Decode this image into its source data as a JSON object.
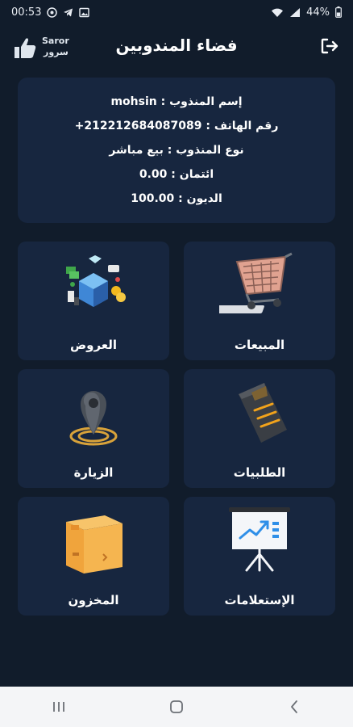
{
  "status_bar": {
    "time": "00:53",
    "battery": "44%",
    "icons": [
      "whatsapp-icon",
      "telegram-icon",
      "gallery-icon",
      "wifi-icon",
      "signal-icon",
      "battery-icon"
    ]
  },
  "header": {
    "title": "فضاء المندوبين",
    "logo_text": "Saror",
    "logo_text_ar": "سرور"
  },
  "info": {
    "name_label": "إسم المنذوب :",
    "name_value": "mohsin",
    "phone_label": "رقم الهاتف :",
    "phone_value": "+212212684087089",
    "type_label": "نوع المنذوب :",
    "type_value": "بيع مباشر",
    "credit_label": "ائتمان :",
    "credit_value": "0.00",
    "debt_label": "الديون :",
    "debt_value": "100.00"
  },
  "tiles": {
    "sales": "المبيعات",
    "offers": "العروض",
    "orders": "الطلبيات",
    "visit": "الزيارة",
    "reports": "الإستعلامات",
    "stock": "المخزون"
  },
  "colors": {
    "background": "#111c2b",
    "card": "#17263f",
    "navbar": "#f4f5f7"
  }
}
